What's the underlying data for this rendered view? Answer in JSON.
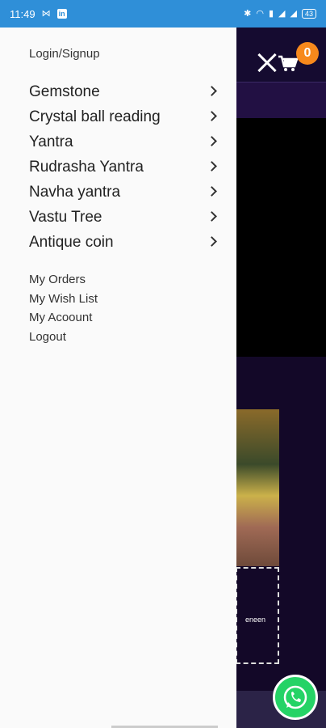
{
  "status_bar": {
    "time": "11:49",
    "battery": "43"
  },
  "drawer": {
    "login_label": "Login/Signup",
    "menu_items": [
      {
        "label": "Gemstone"
      },
      {
        "label": "Crystal ball reading"
      },
      {
        "label": "Yantra"
      },
      {
        "label": "Rudrasha Yantra"
      },
      {
        "label": "Navha yantra"
      },
      {
        "label": "Vastu Tree"
      },
      {
        "label": "Antique coin"
      }
    ],
    "account_links": [
      {
        "label": "My Orders"
      },
      {
        "label": "My Wish List"
      },
      {
        "label": "My Acoount"
      },
      {
        "label": "Logout"
      }
    ]
  },
  "header": {
    "cart_count": "0"
  },
  "background": {
    "partial_text": "eneen"
  },
  "colors": {
    "status_bar": "#2f8fd8",
    "drawer_bg": "#fafafa",
    "badge": "#f7891c",
    "whatsapp": "#25d366"
  }
}
